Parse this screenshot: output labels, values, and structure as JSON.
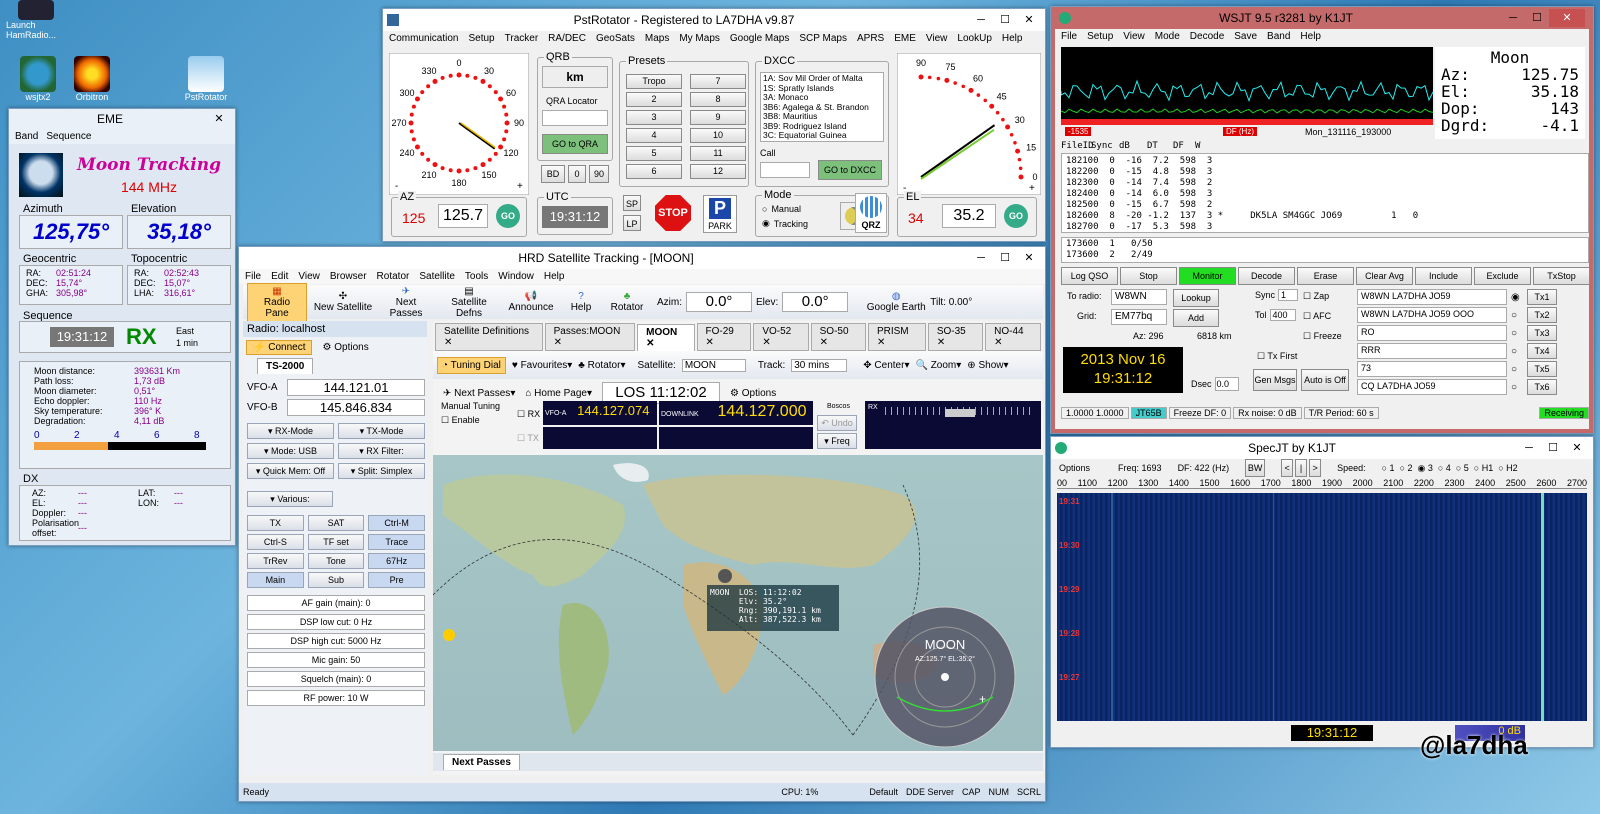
{
  "desktop": {
    "icons": [
      {
        "label": "Launch HamRadio..."
      },
      {
        "label": "wsjtx2"
      },
      {
        "label": "Orbitron"
      },
      {
        "label": "PstRotator"
      }
    ],
    "watermark": "@la7dha"
  },
  "eme": {
    "title": "EME",
    "menu": [
      "Band",
      "Sequence"
    ],
    "moon_tracking": "Moon Tracking",
    "band": "144 MHz",
    "azimuth_label": "Azimuth",
    "azimuth": "125,75°",
    "elevation_label": "Elevation",
    "elevation": "35,18°",
    "geocentric_label": "Geocentric",
    "topocentric_label": "Topocentric",
    "geo": [
      [
        "RA:",
        "02:51:24"
      ],
      [
        "DEC:",
        "15,74°"
      ],
      [
        "GHA:",
        "305,98°"
      ]
    ],
    "topo": [
      [
        "RA:",
        "02:52:43"
      ],
      [
        "DEC:",
        "15,07°"
      ],
      [
        "LHA:",
        "316,61°"
      ]
    ],
    "sequence_label": "Sequence",
    "time": "19:31:12",
    "rx": "RX",
    "east": "East",
    "min": "1 min",
    "stats": [
      [
        "Moon distance:",
        "393631 Km"
      ],
      [
        "Path loss:",
        "1,73 dB"
      ],
      [
        "Moon diameter:",
        "0,51°"
      ],
      [
        "Echo doppler:",
        "110 Hz"
      ],
      [
        "Sky temperature:",
        "396° K"
      ],
      [
        "Degradation:",
        "4,11 dB"
      ]
    ],
    "scale": [
      "0",
      "2",
      "4",
      "6",
      "8"
    ],
    "dx_label": "DX",
    "dx": [
      [
        "AZ:",
        "---",
        "LAT:",
        "---"
      ],
      [
        "EL:",
        "---",
        "LON:",
        "---"
      ],
      [
        "Doppler:",
        "---",
        "",
        ""
      ],
      [
        "Polarisation offset:",
        "---",
        "",
        ""
      ]
    ]
  },
  "pst": {
    "title": "PstRotator - Registered to LA7DHA    v9.87",
    "menu": [
      "Communication",
      "Setup",
      "Tracker",
      "RA/DEC",
      "GeoSats",
      "Maps",
      "My Maps",
      "Google Maps",
      "SCP Maps",
      "APRS",
      "EME",
      "View",
      "LookUp",
      "Help"
    ],
    "az_ticks": [
      "0",
      "30",
      "60",
      "90",
      "120",
      "150",
      "180",
      "210",
      "240",
      "270",
      "300",
      "330"
    ],
    "qrb_label": "QRB",
    "qrb_unit": "km",
    "qra_label": "QRA Locator",
    "goto_qra": "GO to QRA",
    "bd": "BD",
    "bd0": "0",
    "bd90": "90",
    "presets_label": "Presets",
    "presets": [
      "Tropo",
      "7",
      "2",
      "8",
      "3",
      "9",
      "4",
      "10",
      "5",
      "11",
      "6",
      "12"
    ],
    "dxcc_label": "DXCC",
    "dxcc": [
      "1A:  Sov Mil Order of Malta",
      "1S:  Spratly Islands",
      "3A:  Monaco",
      "3B6:  Agalega & St. Brandon",
      "3B8:  Mauritius",
      "3B9:  Rodriguez Island",
      "3C:  Equatorial Guinea"
    ],
    "call_label": "Call",
    "goto_dxcc": "GO to DXCC",
    "utc_label": "UTC",
    "utc": "19:31:12",
    "az_label": "AZ",
    "az_actual": "125",
    "az_value": "125.7",
    "go": "GO",
    "sp": "SP",
    "lp": "LP",
    "stop": "STOP",
    "park": "PARK",
    "mode_label": "Mode",
    "manual": "Manual",
    "tracking": "Tracking",
    "qrz": "QRZ",
    "el_ticks": [
      "90",
      "75",
      "60",
      "45",
      "30",
      "15",
      "0"
    ],
    "el_label": "EL",
    "el_actual": "34",
    "el_value": "35.2"
  },
  "hrd": {
    "title": "HRD Satellite Tracking - [MOON]",
    "menu": [
      "File",
      "Edit",
      "View",
      "Browser",
      "Rotator",
      "Satellite",
      "Tools",
      "Window",
      "Help"
    ],
    "toolbar": [
      "Radio Pane",
      "New Satellite",
      "Next Passes",
      "Satellite Defns",
      "Announce",
      "Help",
      "Rotator"
    ],
    "azim_label": "Azim:",
    "azim": "0.0°",
    "elev_label": "Elev:",
    "elev": "0.0°",
    "google_earth": "Google Earth",
    "tilt": "Tilt:   0.00°",
    "radio_label": "Radio: localhost",
    "connect": "Connect",
    "options": "Options",
    "ts2000": "TS-2000",
    "vfoa_label": "VFO-A",
    "vfoa": "144.121.01",
    "vfob_label": "VFO-B",
    "vfob": "145.846.834",
    "radio_btns": [
      [
        "RX-Mode",
        "TX-Mode"
      ],
      [
        "Mode: USB",
        "RX Filter:"
      ],
      [
        "Quick Mem: Off",
        "Split: Simplex"
      ]
    ],
    "various": "Various:",
    "grid": [
      "TX",
      "SAT",
      "Ctrl-M",
      "Ctrl-S",
      "TF set",
      "Trace",
      "TrRev",
      "Tone",
      "67Hz",
      "Main",
      "Sub",
      "Pre"
    ],
    "sliders": [
      "AF gain (main): 0",
      "DSP low cut: 0 Hz",
      "DSP high cut: 5000 Hz",
      "Mic gain: 50",
      "Squelch (main): 0",
      "RF power: 10 W"
    ],
    "tabs": [
      "Satellite Definitions",
      "Passes:MOON",
      "MOON",
      "FO-29",
      "VO-52",
      "SO-50",
      "PRISM",
      "SO-35",
      "NO-44"
    ],
    "tool2": [
      "Tuning Dial",
      "Favourites",
      "Rotator",
      "Satellite:",
      "Track:",
      "Center",
      "Zoom",
      "Show"
    ],
    "satellite": "MOON",
    "track": "30 mins",
    "next_passes": "Next Passes",
    "home_page": "Home Page",
    "los": "LOS 11:12:02",
    "options2": "Options",
    "manual_tuning": "Manual Tuning",
    "enable": "Enable",
    "rx": "RX",
    "tx": "TX",
    "vfoa2": "VFO-A",
    "vfoa2_val": "144.127.074",
    "downlink": "DOWNLINK",
    "downlink_val": "144.127.000",
    "boscos": "Boscos",
    "undo": "Undo",
    "freq": "Freq",
    "moon_info": [
      "MOON  LOS: 11:12:02",
      "      Elv: 35.2°",
      "      Rng: 390,191.1 km",
      "      Alt: 387,522.3 km"
    ],
    "radar_title": "MOON",
    "radar_sub": "AZ:125.7° EL:35.2°",
    "bottom_tab": "Next Passes",
    "status": [
      "Ready",
      "CPU: 1%",
      "Default",
      "DDE Server",
      "CAP",
      "NUM",
      "SCRL"
    ]
  },
  "wsjt": {
    "title": "WSJT 9.5    r3281    by K1JT",
    "menu": [
      "File",
      "Setup",
      "View",
      "Mode",
      "Decode",
      "Save",
      "Band",
      "Help"
    ],
    "moon": [
      [
        "Moon",
        ""
      ],
      [
        "Az:",
        "125.75"
      ],
      [
        "El:",
        "35.18"
      ],
      [
        "Dop:",
        "143"
      ],
      [
        "Dgrd:",
        "-4.1"
      ]
    ],
    "scale_l": "-1535",
    "scale_m": "DF (Hz)",
    "file": "Mon_131116_193000",
    "header": [
      "FileID",
      "Sync",
      "dB",
      "DT",
      "DF",
      "W"
    ],
    "rows": [
      "182100  0  -16  7.2  598  3",
      "182200  0  -15  4.8  598  3",
      "182300  0  -14  7.4  598  2",
      "182400  0  -14  6.0  598  3",
      "182500  0  -15  6.7  598  2",
      "182600  8  -20 -1.2  137  3 *     DK5LA SM4GGC JO69         1   0",
      "182700  0  -17  5.3  598  3"
    ],
    "rows2": [
      "173600  1   0/50",
      "173600  2   2/49"
    ],
    "buttons": [
      "Log QSO",
      "Stop",
      "Monitor",
      "Decode",
      "Erase",
      "Clear Avg",
      "Include",
      "Exclude",
      "TxStop"
    ],
    "to_radio_label": "To radio:",
    "to_radio": "W8WN",
    "lookup": "Lookup",
    "grid_label": "Grid:",
    "grid": "EM77bq",
    "add": "Add",
    "az": "Az: 296",
    "km": "6818 km",
    "date": "2013 Nov 16",
    "time": "19:31:12",
    "sync_label": "Sync",
    "sync": "1",
    "tol_label": "Tol",
    "tol": "400",
    "zap": "Zap",
    "afc": "AFC",
    "freeze": "Freeze",
    "txfirst": "Tx First",
    "gen": "Gen Msgs",
    "auto": "Auto is Off",
    "dsec_label": "Dsec",
    "dsec": "0.0",
    "msgs": [
      "W8WN LA7DHA JO59",
      "W8WN LA7DHA JO59 OOO",
      "RO",
      "RRR",
      "73",
      "CQ LA7DHA JO59"
    ],
    "tx": [
      "Tx1",
      "Tx2",
      "Tx3",
      "Tx4",
      "Tx5",
      "Tx6"
    ],
    "status": [
      "1.0000  1.0000",
      "JT65B",
      "Freeze DF:  0",
      "Rx noise:  0 dB",
      "T/R Period: 60 s",
      "Receiving"
    ]
  },
  "spec": {
    "title": "SpecJT    by K1JT",
    "options": "Options",
    "freq": "Freq:  1693",
    "df": "DF:  422  (Hz)",
    "bw": "BW",
    "speed": "Speed:",
    "speeds": [
      "1",
      "2",
      "3",
      "4",
      "5",
      "H1",
      "H2"
    ],
    "ticks": [
      "00",
      "1100",
      "1200",
      "1300",
      "1400",
      "1500",
      "1600",
      "1700",
      "1800",
      "1900",
      "2000",
      "2100",
      "2200",
      "2300",
      "2400",
      "2500",
      "2600",
      "2700"
    ],
    "times": [
      "19:31",
      "19:30",
      "19:29",
      "19:28",
      "19:27"
    ],
    "time": "19:31:12",
    "db": "0 dB"
  }
}
